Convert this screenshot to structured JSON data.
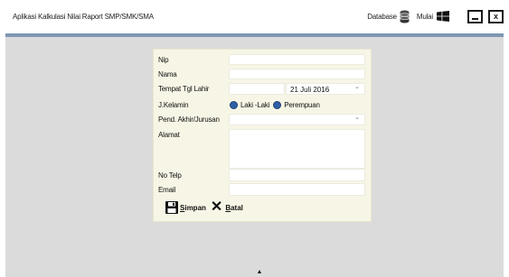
{
  "app": {
    "title": "Aplikasi Kalkulasi Nilai Raport SMP/SMK/SMA"
  },
  "toolbar": {
    "database_label": "Database",
    "mulai_label": "Mulai"
  },
  "window_controls": {
    "minimize_icon": "minimize-icon",
    "close_icon": "close-icon"
  },
  "form": {
    "nip_label": "Nip",
    "nama_label": "Nama",
    "tempat_tgl_lahir_label": "Tempat Tgl Lahir",
    "tanggal_lahir_value": "21 Juli 2016",
    "jenis_kelamin_label": "J.Kelamin",
    "gender_options": [
      "Laki -Laki",
      "Perempuan"
    ],
    "pendidikan_label": "Pend. Akhir/Jurusan",
    "alamat_label": "Alamat",
    "no_telp_label": "No Telp",
    "email_label": "Email",
    "nip_value": "",
    "nama_value": "",
    "tempat_value": "",
    "pendidikan_value": "",
    "alamat_value": "",
    "no_telp_value": "",
    "email_value": ""
  },
  "actions": {
    "save_first": "S",
    "save_rest": "impan",
    "cancel_first": "B",
    "cancel_rest": "atal"
  },
  "colors": {
    "accent": "#7e97b3",
    "workspace": "#dbdbdb",
    "form_bg": "#f7f6e6",
    "radio": "#2f5fa7"
  }
}
